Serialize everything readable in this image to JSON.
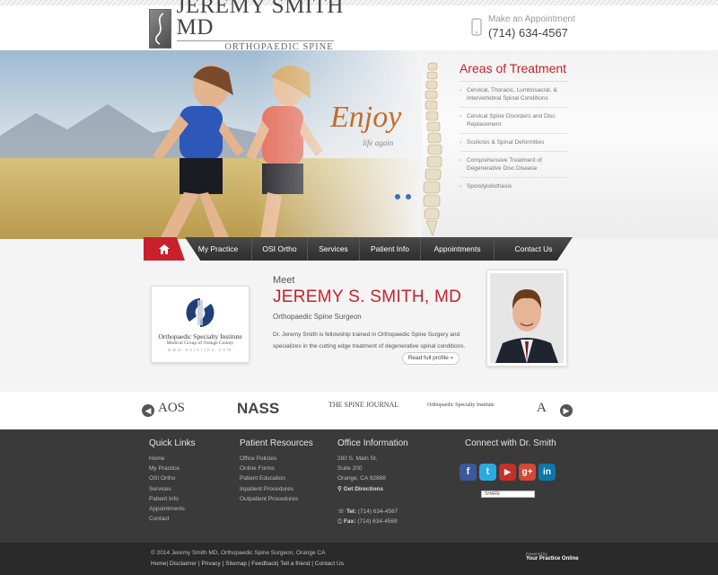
{
  "header": {
    "logo_name": "JEREMY SMITH MD",
    "logo_tagline": "ORTHOPAEDIC SPINE SURGEON",
    "appointment_label": "Make an Appointment",
    "appointment_phone": "(714) 634-4567"
  },
  "hero": {
    "tagline": "Enjoy",
    "tagline_sub": "life again",
    "slider_dots": 2,
    "areas_title": "Areas of Treatment",
    "areas": [
      "Cervical, Thoracic, Lumbosacral, & Intervertebral Spinal Conditions",
      "Cervical Spine Disorders and Disc Replacement",
      "Scoliosis & Spinal Deformities",
      "Comprehensive Treatment of Degenerative Disc Disease",
      "Spondylolisthesis"
    ]
  },
  "nav": {
    "home_icon": "home-icon",
    "items": [
      "My Practice",
      "OSI Ortho",
      "Services",
      "Patient Info",
      "Appointments",
      "Contact Us"
    ]
  },
  "meet": {
    "label": "Meet",
    "name": "JEREMY S. SMITH, MD",
    "title": "Orthopaedic Spine Surgeon",
    "bio": "Dr. Jeremy Smith is fellowship trained in Orthopaedic Spine Surgery and specializes in the cutting edge treatment of degenerative spinal conditions.",
    "read_more": "Read full profile »",
    "osi_name": "Orthopaedic Specialty Institute",
    "osi_sub": "Medical Group of Orange County",
    "osi_url": "www.osiortho.com"
  },
  "partners": [
    "AOS",
    "NASS",
    "THE SPINE JOURNAL",
    "Orthopaedic Specialty Institute",
    "A"
  ],
  "footer": {
    "quick_links_title": "Quick Links",
    "quick_links": [
      "Home",
      "My Practice",
      "OSI Ortho",
      "Services",
      "Patient Info",
      "Appointments",
      "Contact"
    ],
    "patient_title": "Patient Resources",
    "patient_links": [
      "Office Policies",
      "Online Forms",
      "Patient Education",
      "Inpatient Procedures",
      "Outpatient Procedures"
    ],
    "office_title": "Office Information",
    "address1": "280 S. Main St.",
    "address2": "Suite 200",
    "address3": "Orange, CA 92868",
    "directions": "Get Directions",
    "tel_label": "Tel:",
    "tel": "(714) 634-4567",
    "fax_label": "Fax:",
    "fax": "(714) 634-4569",
    "connect_title": "Connect with Dr. Smith",
    "social": [
      {
        "icon": "facebook-icon",
        "glyph": "f",
        "color": "#3b5998"
      },
      {
        "icon": "twitter-icon",
        "glyph": "t",
        "color": "#2aa9e0"
      },
      {
        "icon": "youtube-icon",
        "glyph": "▶",
        "color": "#c4302b"
      },
      {
        "icon": "googleplus-icon",
        "glyph": "g+",
        "color": "#d34836"
      },
      {
        "icon": "linkedin-icon",
        "glyph": "in",
        "color": "#0e76a8"
      }
    ],
    "share_label": "SHARE"
  },
  "bottom": {
    "copyright": "© 2014 Jeremy Smith MD, Orthopaedic Spine Surgeon, Orange CA",
    "links": [
      "Home",
      "Disclaimer",
      "Privacy",
      "Sitemap",
      "Feedback",
      "Tell a friend",
      "Contact Us"
    ],
    "powered_label": "Powered by",
    "powered_brand": "Your Practice Online"
  },
  "colors": {
    "accent": "#c8202c",
    "nav": "#333333",
    "footer": "#3a3a3a"
  }
}
